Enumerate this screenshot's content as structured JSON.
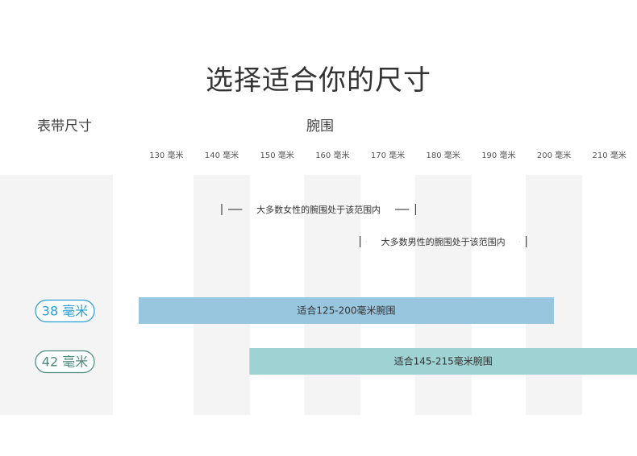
{
  "page": {
    "title": "选择适合你的尺寸",
    "band_size_header": "表带尺寸",
    "wrist_header": "腕围"
  },
  "colors": {
    "column_shade": "#f4f4f4",
    "band_38": "#98c6df",
    "band_42": "#9fd3d3",
    "pill_38_border": "#2a9ed6",
    "pill_42_border": "#4d8a80"
  },
  "chart_data": {
    "type": "bar",
    "orientation": "horizontal",
    "x_unit": "毫米",
    "x_ticks": [
      130,
      140,
      150,
      160,
      170,
      180,
      190,
      200,
      210
    ],
    "x_tick_labels": [
      "130 毫米",
      "140 毫米",
      "150 毫米",
      "160 毫米",
      "170 毫米",
      "180 毫米",
      "190 毫米",
      "200 毫米",
      "210 毫米"
    ],
    "xlim": [
      125,
      215
    ],
    "ranges": [
      {
        "label": "38 毫米",
        "start": 125,
        "end": 200,
        "text": "适合125-200毫米腕围"
      },
      {
        "label": "42 毫米",
        "start": 145,
        "end": 215,
        "text": "适合145-215毫米腕围"
      }
    ],
    "annotations": [
      {
        "text": "大多数女性的腕围处于该范围内",
        "start": 140,
        "end": 175
      },
      {
        "text": "大多数男性的腕围处于该范围内",
        "start": 165,
        "end": 195
      }
    ]
  }
}
